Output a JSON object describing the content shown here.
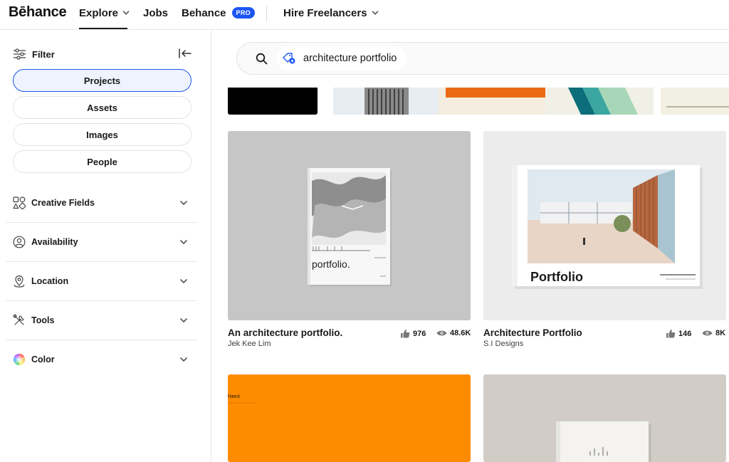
{
  "nav": {
    "logo": "Bēhance",
    "explore": "Explore",
    "jobs": "Jobs",
    "behance": "Behance",
    "pro_badge": "PRO",
    "hire": "Hire Freelancers"
  },
  "sidebar": {
    "filter_label": "Filter",
    "types": [
      "Projects",
      "Assets",
      "Images",
      "People"
    ],
    "active_type": "Projects",
    "sections": [
      {
        "label": "Creative Fields",
        "icon": "shapes-icon"
      },
      {
        "label": "Availability",
        "icon": "person-circle-icon"
      },
      {
        "label": "Location",
        "icon": "location-pin-icon"
      },
      {
        "label": "Tools",
        "icon": "tools-icon"
      },
      {
        "label": "Color",
        "icon": "color-wheel-icon"
      }
    ]
  },
  "search": {
    "query": "architecture portfolio"
  },
  "projects": [
    {
      "title": "An architecture portfolio.",
      "owner": "Jek Kee Lim",
      "likes": "976",
      "views": "48.6K",
      "cover_text": "portfolio."
    },
    {
      "title": "Architecture Portfolio",
      "owner": "S.I Designs",
      "likes": "146",
      "views": "8K",
      "cover_text": "Portfolio"
    },
    {
      "title": "",
      "owner": "",
      "likes": "",
      "views": "",
      "cover_text": "hmed"
    },
    {
      "title": "",
      "owner": "",
      "likes": "",
      "views": "",
      "cover_text": ""
    }
  ],
  "colors": {
    "accent": "#1b55f5",
    "active_bg": "#eef3fd",
    "orange": "#ff8c00"
  }
}
